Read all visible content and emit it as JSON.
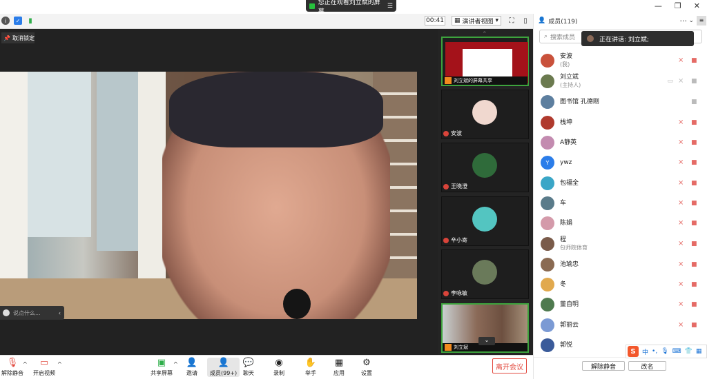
{
  "share_banner": {
    "text": "您正在观看刘立斌的屏幕",
    "menu_icon": "menu-icon"
  },
  "toolbar": {
    "timer": "00:41",
    "view_label": "演讲者视图"
  },
  "stage": {
    "unlock_label": "取消锁定",
    "comment_placeholder": "说点什么..."
  },
  "thumbnails": [
    {
      "name": "刘立斌的屏幕共享",
      "kind": "share"
    },
    {
      "name": "安波",
      "avatar_color": "#f0d8cf"
    },
    {
      "name": "王晓澄",
      "avatar_color": "#2f6b3a"
    },
    {
      "name": "辛小寄",
      "avatar_color": "#53c5c1"
    },
    {
      "name": "李咏敏",
      "avatar_color": "#6a7a5a"
    },
    {
      "name": "刘立斌",
      "avatar_color": "#8b6a58"
    }
  ],
  "bottom_bar": {
    "unmute": "解除静音",
    "start_video": "开启视频",
    "share": "共享屏幕",
    "invite": "邀请",
    "members": "成员(99+)",
    "chat": "聊天",
    "record": "录制",
    "raise_hand": "举手",
    "apps": "应用",
    "settings": "设置",
    "leave": "离开会议"
  },
  "panel": {
    "title": "成员(119)",
    "search_placeholder": "搜索成员",
    "speaking": "正在讲话: 刘立斌;",
    "members": [
      {
        "name": "安波",
        "sub": "(我)",
        "color": "#c9513b"
      },
      {
        "name": "刘立斌",
        "sub": "(主持人)",
        "color": "#6b7a4f"
      },
      {
        "name": "图书馆 孔德刚",
        "sub": "",
        "color": "#5d7f9f"
      },
      {
        "name": "栈坤",
        "sub": "",
        "color": "#b03a2e"
      },
      {
        "name": "A静英",
        "sub": "",
        "color": "#c38bb0"
      },
      {
        "name": "ywz",
        "sub": "",
        "color": "#2b7de9",
        "initial": "Y"
      },
      {
        "name": "包福全",
        "sub": "",
        "color": "#3aa6c7"
      },
      {
        "name": "车",
        "sub": "",
        "color": "#5a7b8a"
      },
      {
        "name": "陈娟",
        "sub": "",
        "color": "#d49aaa"
      },
      {
        "name": "程",
        "sub": "包师院体育",
        "color": "#7a5b4a"
      },
      {
        "name": "池瑜忠",
        "sub": "",
        "color": "#8a6a52"
      },
      {
        "name": "冬",
        "sub": "",
        "color": "#e1a94e"
      },
      {
        "name": "董自明",
        "sub": "",
        "color": "#4f7a4f"
      },
      {
        "name": "郭丽云",
        "sub": "",
        "color": "#7b9ad4"
      },
      {
        "name": "郭悦",
        "sub": "",
        "color": "#3a5b9a"
      }
    ],
    "unmute_all": "解除静音",
    "rename": "改名"
  },
  "ime": {
    "logo": "S",
    "lang": "中"
  }
}
